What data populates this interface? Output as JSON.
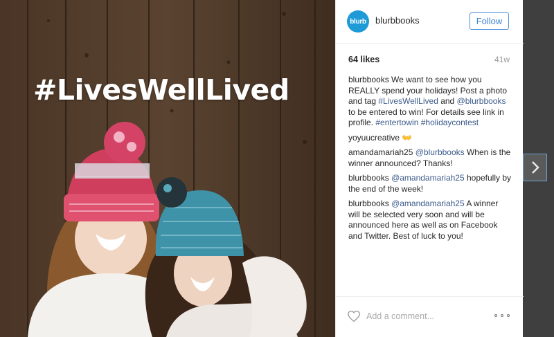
{
  "post": {
    "image_overlay_text": "#LivesWellLived",
    "account": {
      "avatar_text": "blurb",
      "username": "blurbbooks",
      "follow_label": "Follow"
    },
    "likes": "64 likes",
    "time_ago": "41w",
    "caption": {
      "user": "blurbbooks",
      "t1": " We want to see how you REALLY spend your holidays! Post a photo and tag ",
      "l1": "#LivesWellLived",
      "t2": " and ",
      "l2": "@blurbbooks",
      "t3": " to be entered to win! For details see link in profile. ",
      "l3": "#entertowin #holidaycontest"
    },
    "comments": [
      {
        "user": "yoyuucreative",
        "emoji": "👐"
      },
      {
        "user": "amandamariah25",
        "mention": "@blurbbooks",
        "text": " When is the winner announced? Thanks!"
      },
      {
        "user": "blurbbooks",
        "mention": "@amandamariah25",
        "text": " hopefully by the end of the week!"
      },
      {
        "user": "blurbbooks",
        "mention": "@amandamariah25",
        "text": " A winner will be selected very soon and will be announced here as well as on Facebook and Twitter. Best of luck to you!"
      }
    ],
    "comment_placeholder": "Add a comment..."
  },
  "icons": {
    "like": "heart-icon",
    "more": "more-options-icon",
    "next": "chevron-right-icon"
  },
  "colors": {
    "follow_blue": "#3f86d1",
    "link_blue": "#3c5a8a",
    "avatar_blue": "#1e9ad6"
  }
}
